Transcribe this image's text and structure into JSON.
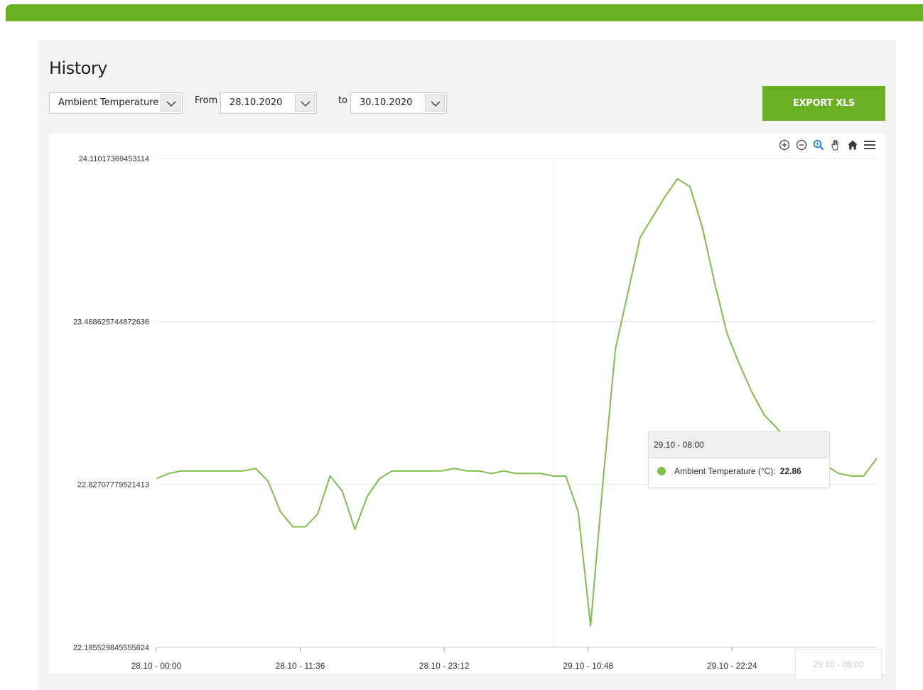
{
  "page": {
    "title": "History",
    "export_label": "EXPORT XLS"
  },
  "filters": {
    "metric": "Ambient Temperature",
    "from_label": "From",
    "from_date": "28.10.2020",
    "to_label": "to",
    "to_date": "30.10.2020"
  },
  "toolbar_icons": [
    "zoom-in-icon",
    "zoom-out-icon",
    "magnifier-icon",
    "pan-hand-icon",
    "home-icon",
    "menu-icon"
  ],
  "colors": {
    "accent": "#6bb023",
    "series": "#7dbf4a"
  },
  "tooltip": {
    "header": "29.10 - 08:00",
    "series_label": "Ambient Temperature (°C):",
    "value": "22.86"
  },
  "crosshair_label": "29.10 - 08:00",
  "chart_data": {
    "type": "line",
    "ylim": [
      22.185529845555624,
      24.11017369453114
    ],
    "ytick_labels": [
      "24.11017369453114",
      "23.468625744872636",
      "22.82707779521413",
      "22.185529845555624"
    ],
    "yticks": [
      24.11017369453114,
      23.468625744872636,
      22.82707779521413,
      22.185529845555624
    ],
    "xtick_labels": [
      "28.10 - 00:00",
      "28.10 - 11:36",
      "28.10 - 23:12",
      "29.10 - 10:48",
      "29.10 - 22:24"
    ],
    "xticks_minutes": [
      0,
      696,
      1392,
      2088,
      2784
    ],
    "xlim_minutes": [
      0,
      3484
    ],
    "crosshair_minutes": 1920,
    "grid": true,
    "series": [
      {
        "name": "Ambient Temperature",
        "x_minutes": [
          0,
          60,
          120,
          180,
          240,
          300,
          360,
          420,
          480,
          540,
          600,
          660,
          720,
          780,
          840,
          900,
          960,
          1020,
          1080,
          1140,
          1200,
          1260,
          1320,
          1380,
          1440,
          1500,
          1560,
          1620,
          1680,
          1740,
          1800,
          1860,
          1920,
          1980,
          2040,
          2100,
          2160,
          2220,
          2280,
          2340,
          2400,
          2460,
          2520,
          2580,
          2640,
          2700,
          2760,
          2820,
          2880,
          2940,
          3000,
          3060,
          3120,
          3180,
          3240,
          3300,
          3360,
          3420,
          3484
        ],
        "values": [
          22.85,
          22.87,
          22.88,
          22.88,
          22.88,
          22.88,
          22.88,
          22.88,
          22.89,
          22.84,
          22.72,
          22.66,
          22.66,
          22.71,
          22.86,
          22.8,
          22.65,
          22.78,
          22.85,
          22.88,
          22.88,
          22.88,
          22.88,
          22.88,
          22.89,
          22.88,
          22.88,
          22.87,
          22.88,
          22.87,
          22.87,
          22.87,
          22.86,
          22.86,
          22.72,
          22.27,
          22.84,
          23.36,
          23.58,
          23.8,
          23.88,
          23.96,
          24.03,
          24.0,
          23.84,
          23.62,
          23.42,
          23.3,
          23.19,
          23.1,
          23.05,
          22.99,
          22.95,
          22.93,
          22.9,
          22.87,
          22.86,
          22.86,
          22.93
        ]
      }
    ]
  }
}
